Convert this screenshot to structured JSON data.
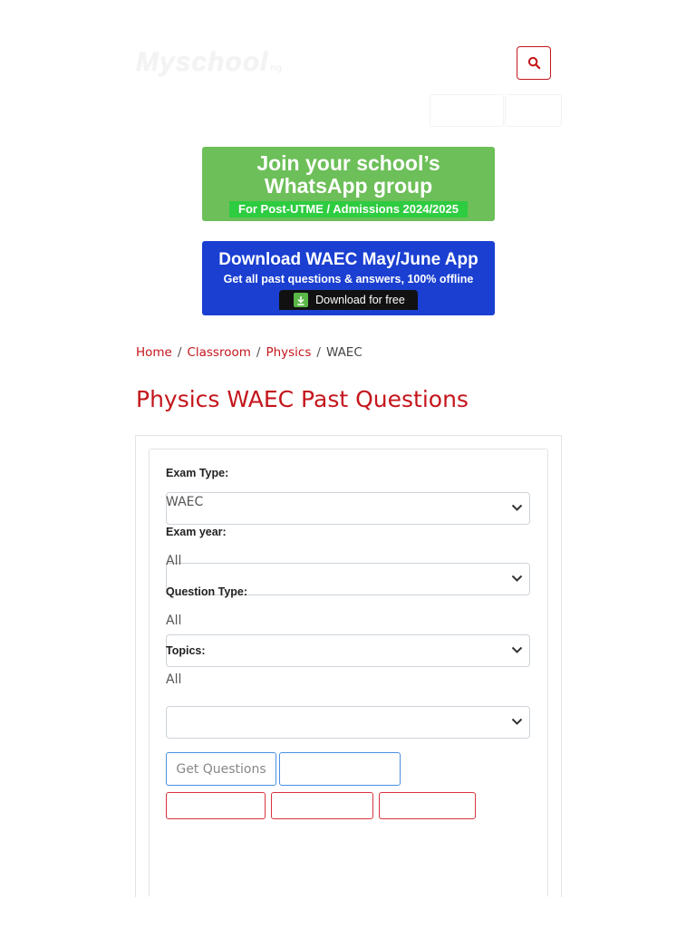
{
  "header": {
    "logo_text": "Myschool",
    "logo_suffix": "ng",
    "search_icon": "search-icon"
  },
  "banners": {
    "whatsapp": {
      "line1": "Join your school’s",
      "line2": "WhatsApp group",
      "line3": "For Post-UTME / Admissions 2024/2025",
      "bg_color": "#6dbf59"
    },
    "app": {
      "line1": "Download WAEC May/June App",
      "line2": "Get all past questions & answers, 100% offline",
      "button": "Download for free",
      "button_icon": "download-icon",
      "bg_color": "#1a3fd1"
    }
  },
  "breadcrumb": {
    "items": [
      "Home",
      "Classroom",
      "Physics"
    ],
    "separator": "/",
    "current": "WAEC"
  },
  "page_title": "Physics WAEC Past Questions",
  "form": {
    "exam_type_label": "Exam Type:",
    "exam_type_value": "WAEC",
    "exam_year_label": "Exam year:",
    "exam_year_value": "All",
    "question_type_label": "Question Type:",
    "question_type_value": "All",
    "topics_label": "Topics:",
    "topics_value": "All",
    "get_questions_label": "Get Questions"
  },
  "colors": {
    "accent": "#c4161c",
    "button_blue": "#4a90e2"
  }
}
